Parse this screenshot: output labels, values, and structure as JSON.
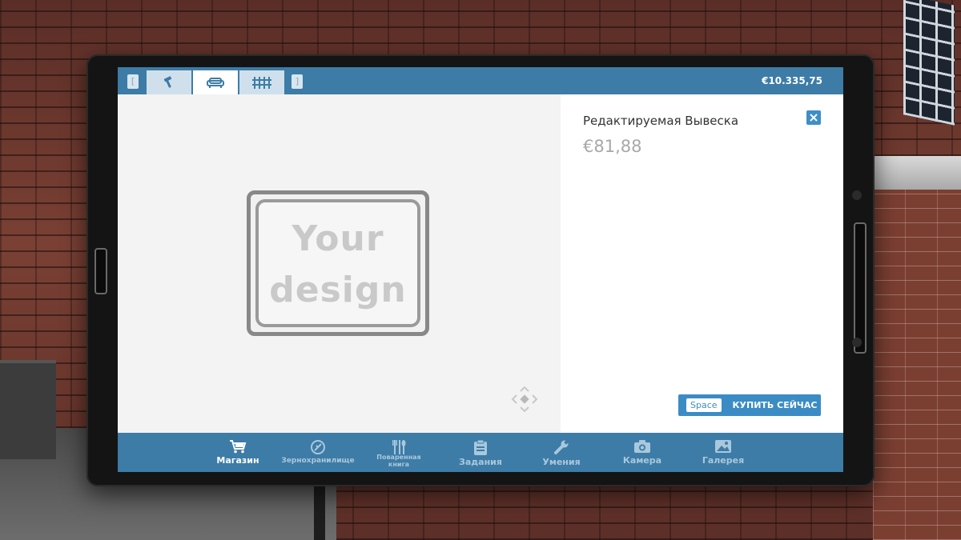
{
  "topbar": {
    "balance": "€10.335,75",
    "tabs": [
      {
        "icon": "hammer-icon"
      },
      {
        "icon": "sofa-icon",
        "active": true
      },
      {
        "icon": "fence-icon"
      }
    ]
  },
  "preview": {
    "sign_line1": "Your",
    "sign_line2": "design"
  },
  "item": {
    "title": "Редактируемая Вывеска",
    "price": "€81,88"
  },
  "buy": {
    "key": "Space",
    "label": "КУПИТЬ СЕЙЧАС"
  },
  "bottomnav": {
    "items": [
      {
        "label": "Магазин",
        "icon": "cart-icon",
        "active": true
      },
      {
        "label": "Зернохранилище",
        "icon": "granary-icon"
      },
      {
        "label": "Поваренная книга",
        "icon": "cutlery-icon"
      },
      {
        "label": "Задания",
        "icon": "clipboard-icon"
      },
      {
        "label": "Умения",
        "icon": "wrench-icon"
      },
      {
        "label": "Камера",
        "icon": "camera-icon"
      },
      {
        "label": "Галерея",
        "icon": "gallery-icon"
      }
    ]
  },
  "colors": {
    "accent": "#3d7ca6",
    "button": "#3b8cc4"
  }
}
